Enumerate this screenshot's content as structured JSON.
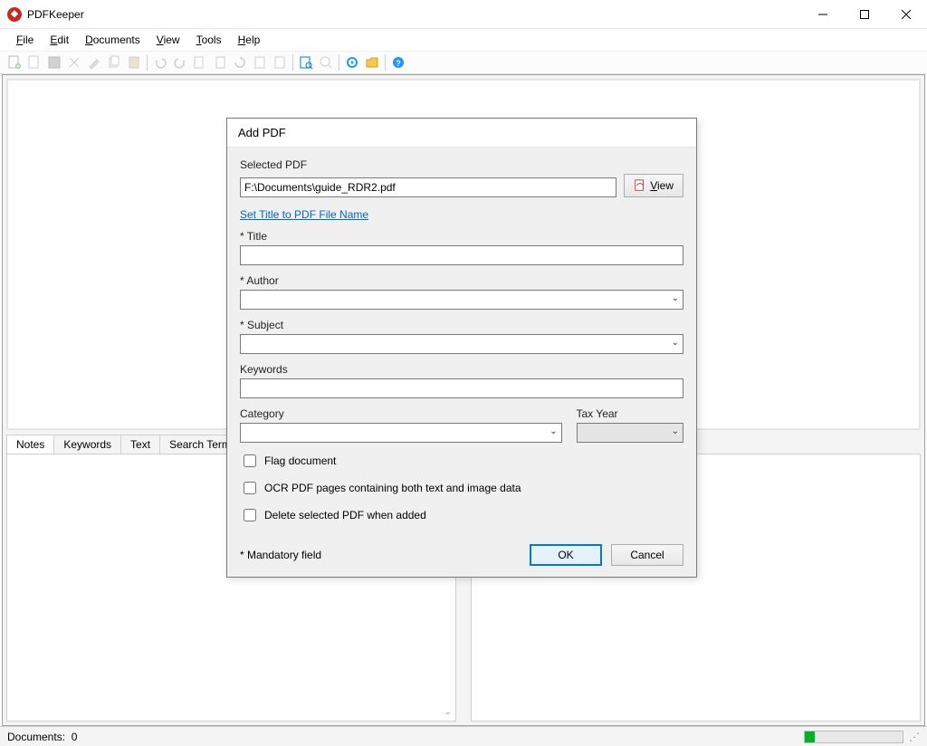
{
  "window": {
    "title": "PDFKeeper"
  },
  "menu": {
    "file": "File",
    "edit": "Edit",
    "documents": "Documents",
    "view": "View",
    "tools": "Tools",
    "help": "Help"
  },
  "tabs": {
    "notes": "Notes",
    "keywords": "Keywords",
    "text": "Text",
    "search": "Search Term S"
  },
  "status": {
    "documents_label": "Documents:",
    "documents_count": "0"
  },
  "dialog": {
    "title": "Add PDF",
    "selected_pdf_label": "Selected PDF",
    "selected_pdf_value": "F:\\Documents\\guide_RDR2.pdf",
    "view_btn_rest": "iew",
    "set_title_link": "Set Title to PDF File Name",
    "title_label": "* Title",
    "author_label": "* Author",
    "subject_label": "* Subject",
    "keywords_label": "Keywords",
    "category_label": "Category",
    "taxyear_label": "Tax Year",
    "flag_rest": "lag document",
    "ocr_rest": "CR PDF pages containing both text and image data",
    "delete_rest": "elete selected PDF when added",
    "mandatory": "* Mandatory field",
    "ok": "OK",
    "cancel": "Cancel"
  }
}
